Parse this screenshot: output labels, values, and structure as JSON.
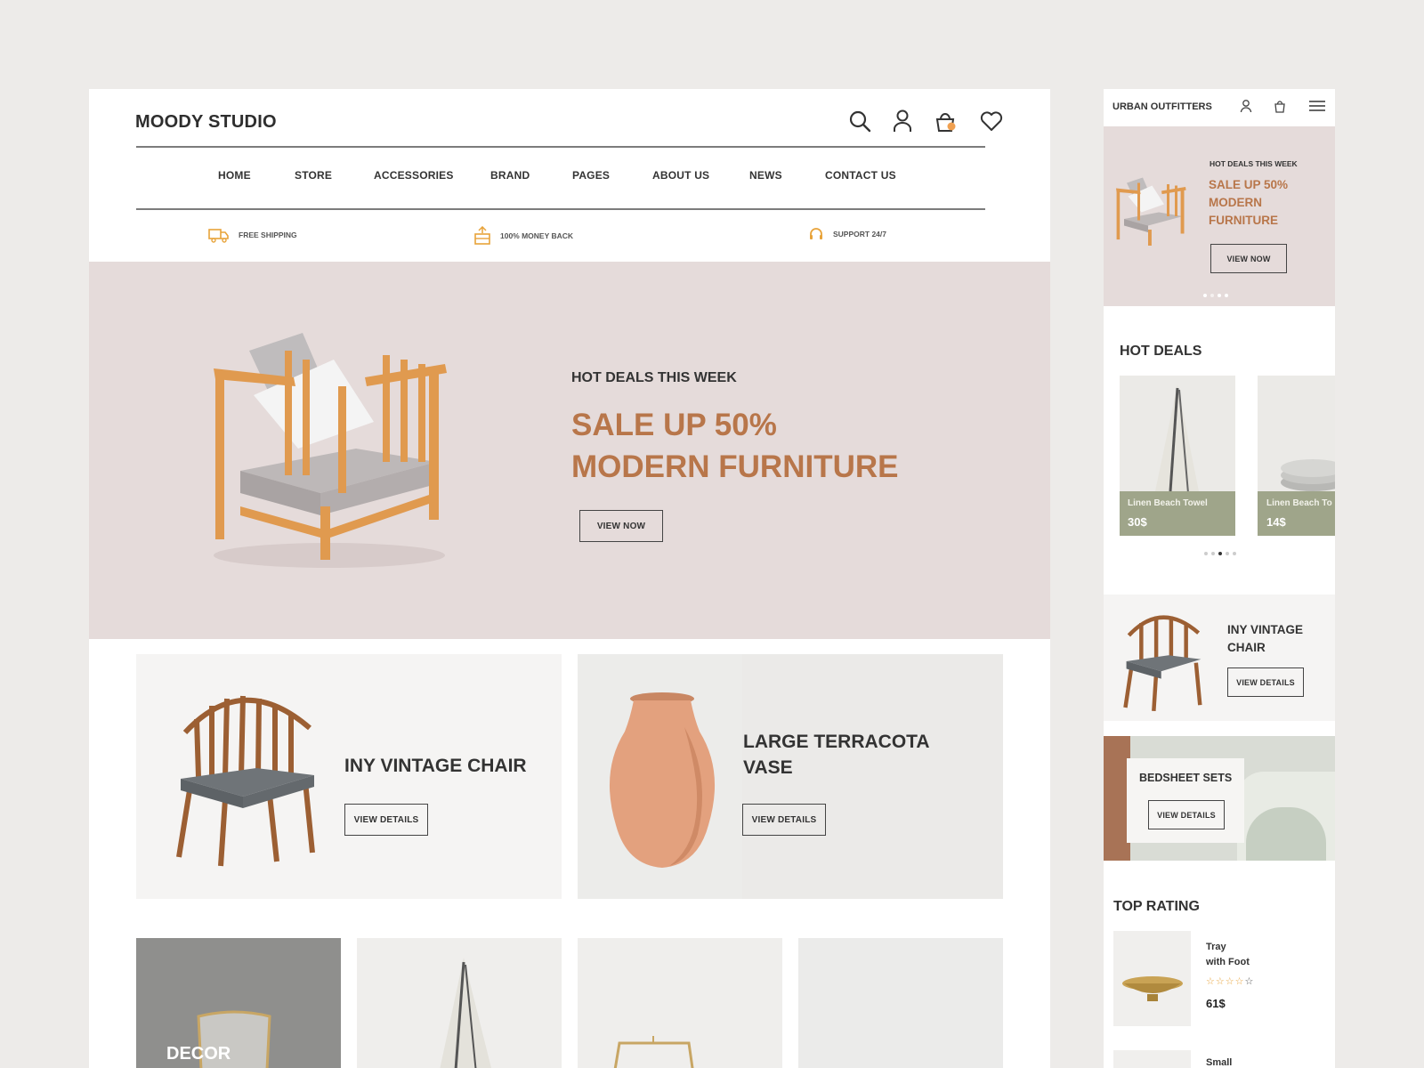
{
  "desktop": {
    "logo": "MOODY STUDIO",
    "nav": [
      "HOME",
      "STORE",
      "ACCESSORIES",
      "BRAND",
      "PAGES",
      "ABOUT US",
      "NEWS",
      "CONTACT US"
    ],
    "features": [
      "FREE SHIPPING",
      "100% MONEY BACK",
      "SUPPORT 24/7"
    ],
    "hero": {
      "kicker": "HOT DEALS THIS WEEK",
      "line1": "SALE UP 50%",
      "line2": "MODERN FURNITURE",
      "button": "VIEW NOW"
    },
    "promos": [
      {
        "title": "INY VINTAGE CHAIR",
        "button": "VIEW DETAILS"
      },
      {
        "title_line1": "LARGE TERRACOTA",
        "title_line2": "VASE",
        "button": "VIEW DETAILS"
      }
    ],
    "categories": [
      {
        "label": "DECOR"
      }
    ]
  },
  "mobile": {
    "brand": "URBAN OUTFITTERS",
    "hero": {
      "kicker": "HOT DEALS THIS WEEK",
      "line1": "SALE UP 50%",
      "line2": "MODERN",
      "line3": "FURNITURE",
      "button": "VIEW NOW"
    },
    "hot_deals": {
      "heading": "HOT DEALS",
      "items": [
        {
          "name": "Linen Beach Towel",
          "price": "30$"
        },
        {
          "name": "Linen Beach To",
          "price": "14$"
        }
      ]
    },
    "promo": {
      "line1": "INY VINTAGE",
      "line2": "CHAIR",
      "button": "VIEW DETAILS"
    },
    "bedsheet": {
      "title": "BEDSHEET SETS",
      "button": "VIEW DETAILS"
    },
    "top_rating": {
      "heading": "TOP RATING",
      "items": [
        {
          "line1": "Tray",
          "line2": "with Foot",
          "stars": 4,
          "price": "61$"
        },
        {
          "line1": "Small"
        }
      ]
    }
  },
  "colors": {
    "accent": "#b8764a",
    "hero_bg": "#e5dbda",
    "page_bg": "#edebe9",
    "towel_label_bg": "#9fa58a",
    "badge": "#f0a050"
  }
}
